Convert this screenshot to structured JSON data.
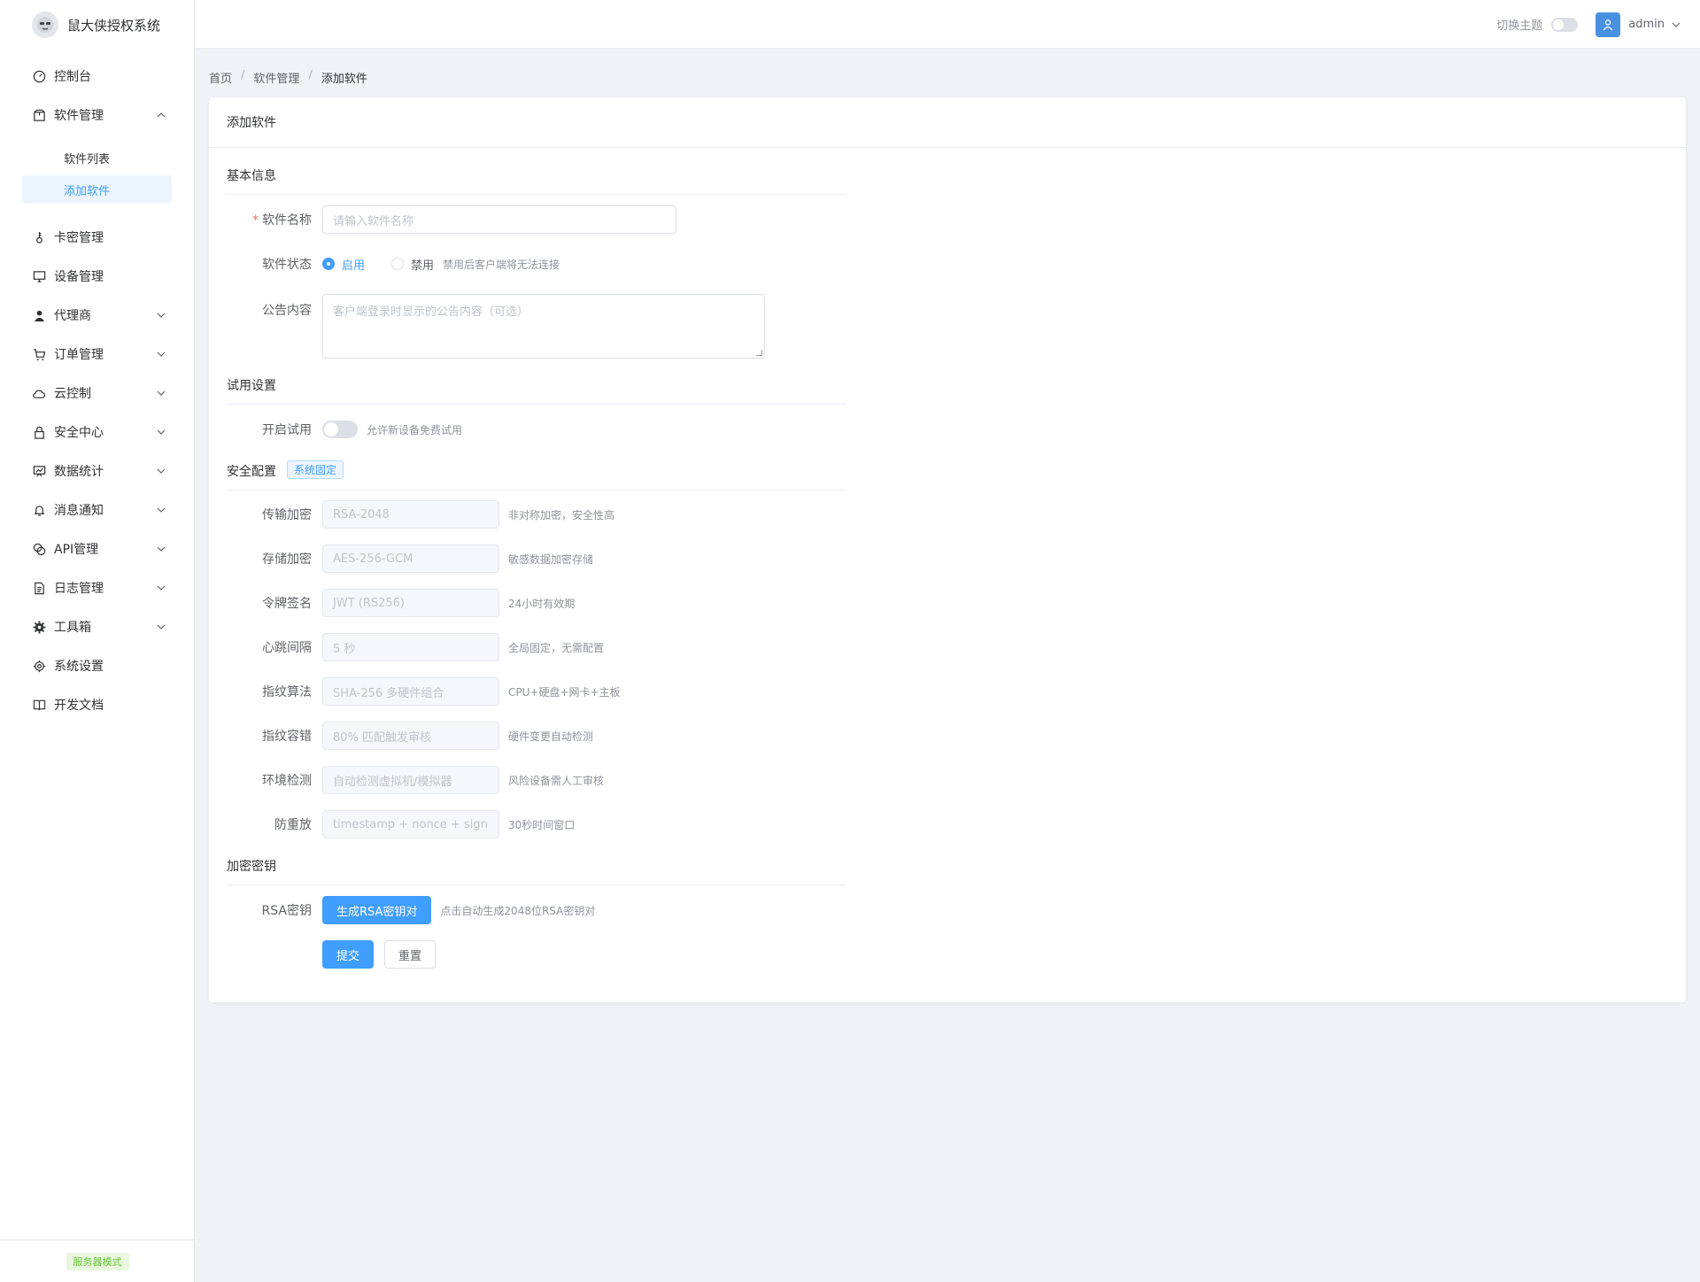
{
  "app": {
    "title": "鼠大侠授权系统"
  },
  "sidebar": {
    "items": [
      {
        "label": "控制台",
        "icon": "dashboard-icon"
      },
      {
        "label": "软件管理",
        "icon": "package-icon",
        "expanded": true,
        "children": [
          {
            "label": "软件列表"
          },
          {
            "label": "添加软件",
            "active": true
          }
        ]
      },
      {
        "label": "卡密管理",
        "icon": "key-icon"
      },
      {
        "label": "设备管理",
        "icon": "monitor-icon"
      },
      {
        "label": "代理商",
        "icon": "user-icon"
      },
      {
        "label": "订单管理",
        "icon": "cart-icon"
      },
      {
        "label": "云控制",
        "icon": "cloud-icon"
      },
      {
        "label": "安全中心",
        "icon": "lock-icon"
      },
      {
        "label": "数据统计",
        "icon": "chart-icon"
      },
      {
        "label": "消息通知",
        "icon": "bell-icon"
      },
      {
        "label": "API管理",
        "icon": "api-icon"
      },
      {
        "label": "日志管理",
        "icon": "document-icon"
      },
      {
        "label": "工具箱",
        "icon": "tools-icon"
      },
      {
        "label": "系统设置",
        "icon": "gear-icon"
      },
      {
        "label": "开发文档",
        "icon": "book-icon"
      }
    ],
    "footer_tag": "服务器模式"
  },
  "header": {
    "theme_label": "切换主题",
    "user_name": "admin"
  },
  "breadcrumb": [
    "首页",
    "软件管理",
    "添加软件"
  ],
  "card": {
    "title": "添加软件"
  },
  "form": {
    "basic": {
      "section": "基本信息",
      "name_label": "软件名称",
      "name_placeholder": "请输入软件名称",
      "status_label": "软件状态",
      "status_enabled": "启用",
      "status_disabled": "禁用",
      "status_hint": "禁用后客户端将无法连接",
      "notice_label": "公告内容",
      "notice_placeholder": "客户端登录时显示的公告内容（可选）"
    },
    "trial": {
      "section": "试用设置",
      "label": "开启试用",
      "hint": "允许新设备免费试用"
    },
    "security": {
      "section": "安全配置",
      "tag": "系统固定",
      "rows": [
        {
          "label": "传输加密",
          "value": "RSA-2048",
          "hint": "非对称加密，安全性高"
        },
        {
          "label": "存储加密",
          "value": "AES-256-GCM",
          "hint": "敏感数据加密存储"
        },
        {
          "label": "令牌签名",
          "value": "JWT (RS256)",
          "hint": "24小时有效期"
        },
        {
          "label": "心跳间隔",
          "value": "5 秒",
          "hint": "全局固定，无需配置"
        },
        {
          "label": "指纹算法",
          "value": "SHA-256 多硬件组合",
          "hint": "CPU+硬盘+网卡+主板"
        },
        {
          "label": "指纹容错",
          "value": "80% 匹配触发审核",
          "hint": "硬件变更自动检测"
        },
        {
          "label": "环境检测",
          "value": "自动检测虚拟机/模拟器",
          "hint": "风险设备需人工审核"
        },
        {
          "label": "防重放",
          "value": "timestamp + nonce + sign",
          "hint": "30秒时间窗口"
        }
      ]
    },
    "keys": {
      "section": "加密密钥",
      "label": "RSA密钥",
      "button": "生成RSA密钥对",
      "hint": "点击自动生成2048位RSA密钥对"
    },
    "submit": "提交",
    "reset": "重置"
  },
  "colors": {
    "primary": "#409eff",
    "success": "#67c23a"
  }
}
